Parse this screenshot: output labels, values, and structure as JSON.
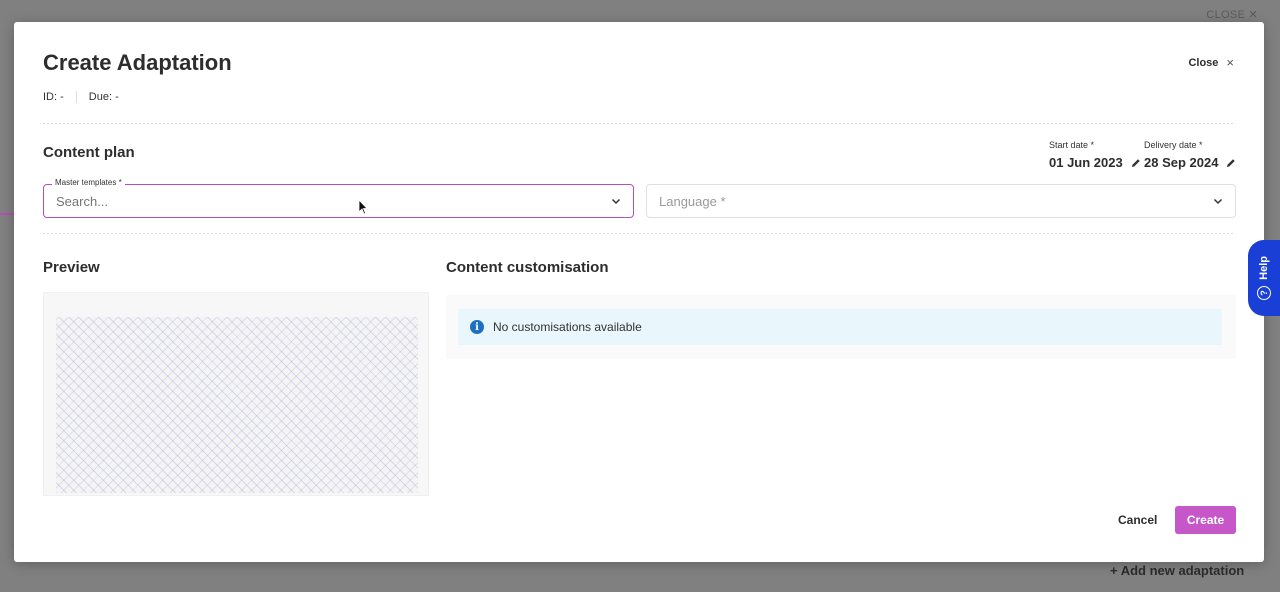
{
  "background": {
    "close_label": "CLOSE ✕",
    "add_new_label": "+ Add new adaptation"
  },
  "modal": {
    "title": "Create Adaptation",
    "close_label": "Close",
    "close_icon": "×",
    "meta": {
      "id_label": "ID: -",
      "due_label": "Due: -"
    },
    "content_plan": {
      "title": "Content plan",
      "start_date": {
        "label": "Start date *",
        "value": "01 Jun 2023"
      },
      "delivery_date": {
        "label": "Delivery date *",
        "value": "28 Sep 2024"
      },
      "master_templates": {
        "label": "Master templates *",
        "placeholder": "Search..."
      },
      "language": {
        "placeholder": "Language *"
      }
    },
    "preview": {
      "title": "Preview"
    },
    "customisation": {
      "title": "Content customisation",
      "info_icon": "i",
      "info_text": "No customisations available"
    },
    "footer": {
      "cancel_label": "Cancel",
      "create_label": "Create"
    }
  },
  "help_tab": {
    "label": "Help",
    "icon": "?"
  },
  "colors": {
    "accent": "#c557c9",
    "accent_border": "#b44fb8",
    "help_blue": "#1a3fd6",
    "info_blue": "#1e6fc2",
    "info_bg": "#e9f6fb"
  }
}
